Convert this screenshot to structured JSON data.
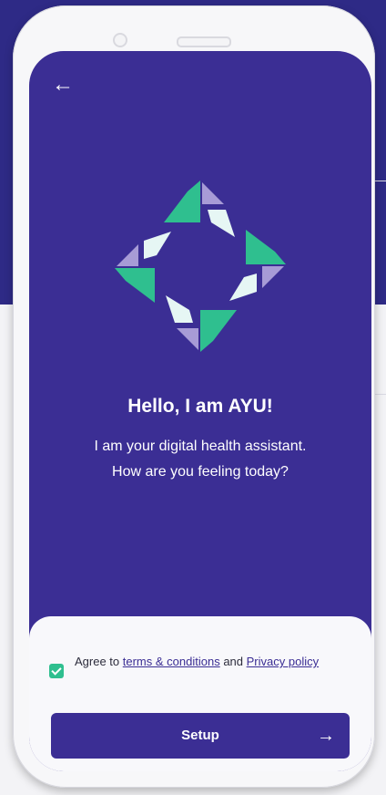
{
  "header": {
    "back_icon": "arrow-left-icon"
  },
  "intro": {
    "title": "Hello, I am AYU!",
    "line1": "I am your digital health assistant.",
    "line2": "How are you feeling today?"
  },
  "agreement": {
    "checked": true,
    "prefix": "Agree to ",
    "terms_link": "terms & conditions",
    "middle": " and ",
    "privacy_link": "Privacy policy"
  },
  "setup": {
    "label": "Setup",
    "icon": "arrow-right-icon"
  },
  "colors": {
    "primary": "#3b2e94",
    "accent": "#2fbf8f",
    "logo_light": "#e6f6f4",
    "logo_lavender": "#a79bd6"
  }
}
